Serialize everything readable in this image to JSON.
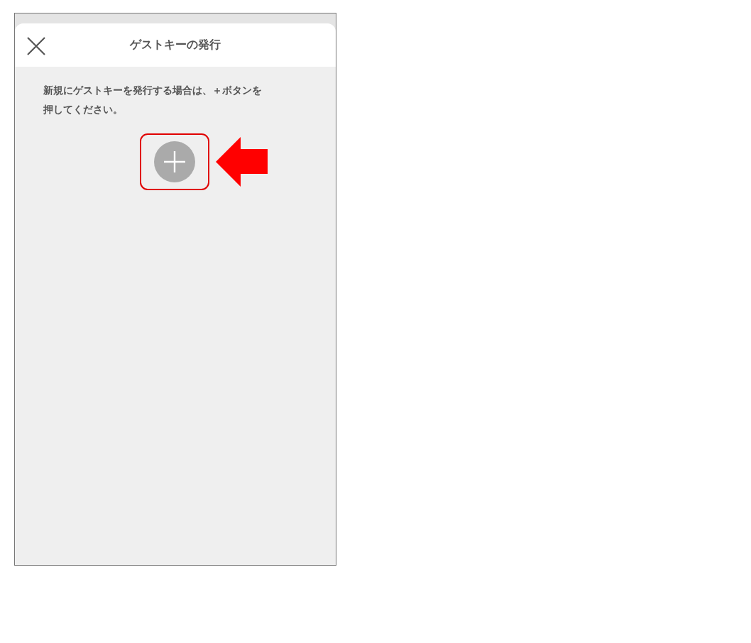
{
  "header": {
    "title": "ゲストキーの発行"
  },
  "instructions": [
    "新規にゲストキーを発行する場合は、＋ボタンを",
    "押してください。"
  ]
}
